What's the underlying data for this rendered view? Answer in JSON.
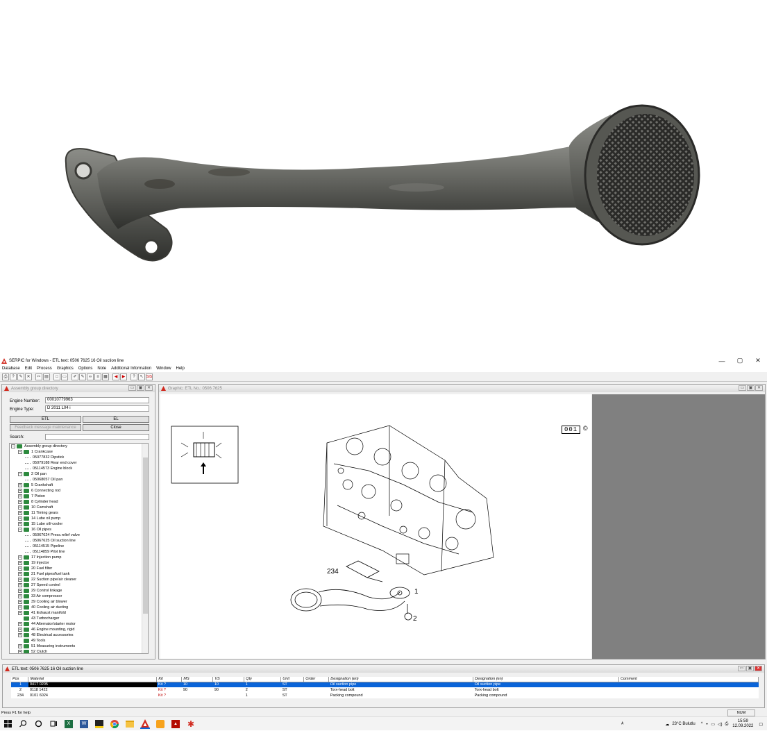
{
  "window": {
    "title": "SERPIC for Windows - ETL text: 0506 7625   16   Oil suction line",
    "controls": {
      "minimize": "—",
      "maximize": "▢",
      "close": "✕"
    }
  },
  "menu": [
    "Database",
    "Edit",
    "Process",
    "Graphics",
    "Options",
    "Note",
    "Additional Information",
    "Window",
    "Help"
  ],
  "assembly_panel": {
    "title": "Assembly group directory",
    "engine_number_label": "Engine Number:",
    "engine_number_value": "00010779963",
    "engine_type_label": "Engine Type:",
    "engine_type_value": "D 2011 L04 i",
    "etl_button": "ETL",
    "el_button": "EL",
    "feedback_button": "Feedback message maintenance",
    "close_button": "Close",
    "search_label": "Search:",
    "search_value": ""
  },
  "tree": [
    {
      "level": 0,
      "pm": "−",
      "icon": true,
      "text": "Assembly group directory"
    },
    {
      "level": 1,
      "pm": "−",
      "icon": true,
      "text": "1  Crankcase"
    },
    {
      "level": 2,
      "pm": "",
      "icon": false,
      "text": "05077832  Dipstick"
    },
    {
      "level": 2,
      "pm": "",
      "icon": false,
      "text": "05079188  Rear end cover"
    },
    {
      "level": 2,
      "pm": "",
      "icon": false,
      "text": "05114573  Engine block"
    },
    {
      "level": 1,
      "pm": "−",
      "icon": true,
      "text": "2  Oil pan"
    },
    {
      "level": 2,
      "pm": "",
      "icon": false,
      "text": "05068057  Oil pan"
    },
    {
      "level": 1,
      "pm": "+",
      "icon": true,
      "text": "5  Crankshaft"
    },
    {
      "level": 1,
      "pm": "+",
      "icon": true,
      "text": "6  Connecting rod"
    },
    {
      "level": 1,
      "pm": "+",
      "icon": true,
      "text": "7  Piston"
    },
    {
      "level": 1,
      "pm": "+",
      "icon": true,
      "text": "8  Cylinder head"
    },
    {
      "level": 1,
      "pm": "+",
      "icon": true,
      "text": "10  Camshaft"
    },
    {
      "level": 1,
      "pm": "+",
      "icon": true,
      "text": "11  Timing gears"
    },
    {
      "level": 1,
      "pm": "+",
      "icon": true,
      "text": "14  Lube oil pump"
    },
    {
      "level": 1,
      "pm": "+",
      "icon": true,
      "text": "15  Lube oil/-cooler"
    },
    {
      "level": 1,
      "pm": "−",
      "icon": true,
      "text": "16  Oil pipes"
    },
    {
      "level": 2,
      "pm": "",
      "icon": false,
      "text": "05067624  Press.relief valve"
    },
    {
      "level": 2,
      "pm": "",
      "icon": false,
      "text": "05067625  Oil suction line"
    },
    {
      "level": 2,
      "pm": "",
      "icon": false,
      "text": "05114515  Pipeline"
    },
    {
      "level": 2,
      "pm": "",
      "icon": false,
      "text": "05114859  Pilot line"
    },
    {
      "level": 1,
      "pm": "+",
      "icon": true,
      "text": "17  Injection pump"
    },
    {
      "level": 1,
      "pm": "+",
      "icon": true,
      "text": "19  Injector"
    },
    {
      "level": 1,
      "pm": "+",
      "icon": true,
      "text": "20  Fuel filter"
    },
    {
      "level": 1,
      "pm": "+",
      "icon": true,
      "text": "21  Fuel pipes/fuel tank"
    },
    {
      "level": 1,
      "pm": "+",
      "icon": true,
      "text": "22  Suction pipe/air cleaner"
    },
    {
      "level": 1,
      "pm": "+",
      "icon": true,
      "text": "27  Speed control"
    },
    {
      "level": 1,
      "pm": "+",
      "icon": true,
      "text": "29  Control linkage"
    },
    {
      "level": 1,
      "pm": "+",
      "icon": true,
      "text": "33  Air compressor"
    },
    {
      "level": 1,
      "pm": "+",
      "icon": true,
      "text": "39  Cooling air blower"
    },
    {
      "level": 1,
      "pm": "+",
      "icon": true,
      "text": "40  Cooling air ducting"
    },
    {
      "level": 1,
      "pm": "+",
      "icon": true,
      "text": "41  Exhaust manifold"
    },
    {
      "level": 1,
      "pm": "",
      "icon": true,
      "text": "43  Turbocharger"
    },
    {
      "level": 1,
      "pm": "+",
      "icon": true,
      "text": "44  Alternator/starter motor"
    },
    {
      "level": 1,
      "pm": "+",
      "icon": true,
      "text": "46  Engine mounting, rigid"
    },
    {
      "level": 1,
      "pm": "+",
      "icon": true,
      "text": "48  Electrical accessories"
    },
    {
      "level": 1,
      "pm": "",
      "icon": true,
      "text": "49  Tools"
    },
    {
      "level": 1,
      "pm": "+",
      "icon": true,
      "text": "51  Measuring instruments"
    },
    {
      "level": 1,
      "pm": "+",
      "icon": true,
      "text": "52  Clutch"
    }
  ],
  "graphic_panel": {
    "title": "Graphic: ETL No.: 0506 7625",
    "figure_number": "001",
    "copyright": "©",
    "callout_234": "234",
    "callout_1": "1",
    "callout_2": "2"
  },
  "etl_panel": {
    "title": "ETL text: 0506 7625   16   Oil suction line",
    "columns": [
      "Pos",
      "Material",
      "Kit",
      "MS",
      "VS",
      "Qty",
      "Unit",
      "Order",
      "Designation (en)",
      "Designation (en)",
      "Comment"
    ],
    "rows": [
      {
        "pos": "1",
        "material": "0417 0205",
        "kit": "Kit ?",
        "ms": "10",
        "vs": "10",
        "qty": "1",
        "unit": "ST",
        "order": "",
        "des1": "Oil suction pipe",
        "des2": "Oil suction pipe",
        "comment": ""
      },
      {
        "pos": "2",
        "material": "0118 1422",
        "kit": "Kit ?",
        "ms": "90",
        "vs": "90",
        "qty": "2",
        "unit": "ST",
        "order": "",
        "des1": "Torx-head bolt",
        "des2": "Torx-head bolt",
        "comment": ""
      },
      {
        "pos": "234",
        "material": "0101 6024",
        "kit": "Kit ?",
        "ms": "",
        "vs": "",
        "qty": "1",
        "unit": "ST",
        "order": "",
        "des1": "Packing compound",
        "des2": "Packing compound",
        "comment": ""
      }
    ]
  },
  "status": {
    "help": "Press F1 for help",
    "num": "NUM"
  },
  "taskbar": {
    "weather": "23°C  Bulutlu",
    "time": "15:59",
    "date": "12.09.2022"
  }
}
